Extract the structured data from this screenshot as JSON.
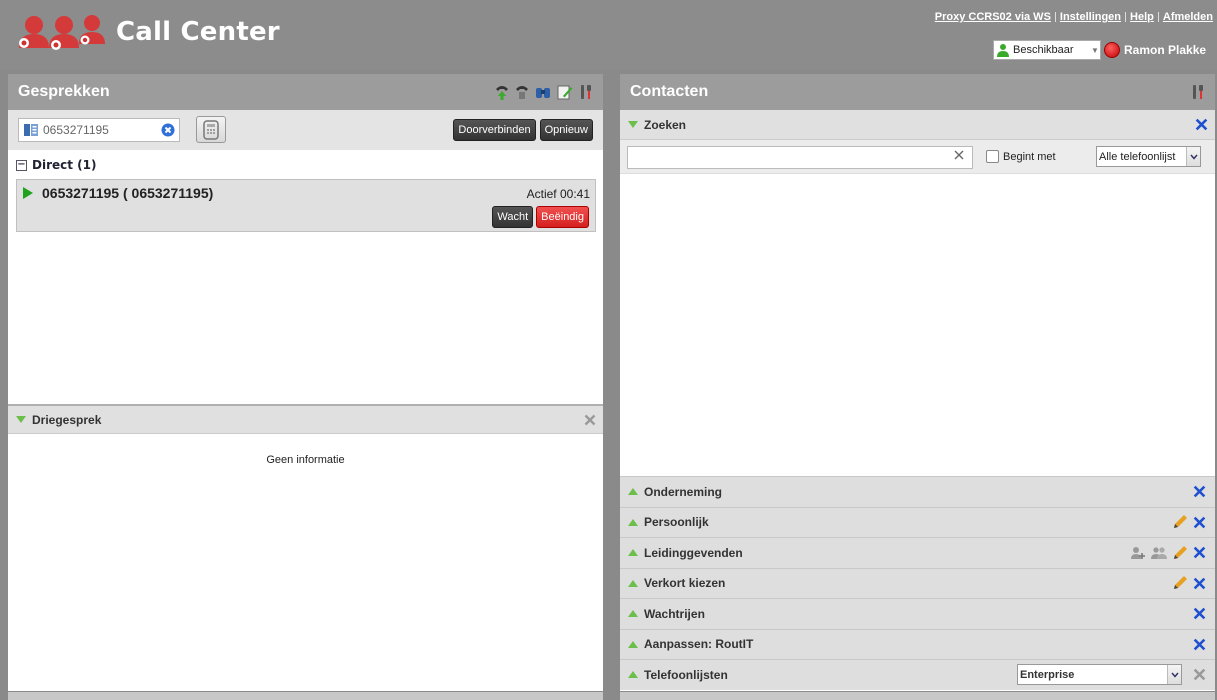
{
  "app": {
    "title": "Call Center"
  },
  "header": {
    "links": [
      "Proxy CCRS02 via WS",
      "Instellingen",
      "Help",
      "Afmelden"
    ],
    "status": "Beschikbaar",
    "user": "Ramon Plakke"
  },
  "left": {
    "title": "Gesprekken",
    "dial_value": "0653271195",
    "btn_transfer": "Doorverbinden",
    "btn_redial": "Opnieuw",
    "direct_label": "Direct (1)",
    "call": {
      "number": "0653271195 ( 0653271195)",
      "status": "Actief 00:41"
    },
    "btn_hold": "Wacht",
    "btn_end": "Beëindig",
    "conference_title": "Driegesprek",
    "conference_empty": "Geen informatie"
  },
  "right": {
    "title": "Contacten",
    "search_title": "Zoeken",
    "search_value": "",
    "begins_with": "Begint met",
    "phonelist_select": "Alle telefoonlijst",
    "sections": [
      "Onderneming",
      "Persoonlijk",
      "Leidinggevenden",
      "Verkort kiezen",
      "Wachtrijen",
      "Aanpassen: RoutIT",
      "Telefoonlijsten"
    ],
    "phonebook_select": "Enterprise"
  },
  "colors": {
    "accent_green": "#6cbf4a",
    "close_blue": "#1d4fd0",
    "end_red": "#d51f1f"
  }
}
